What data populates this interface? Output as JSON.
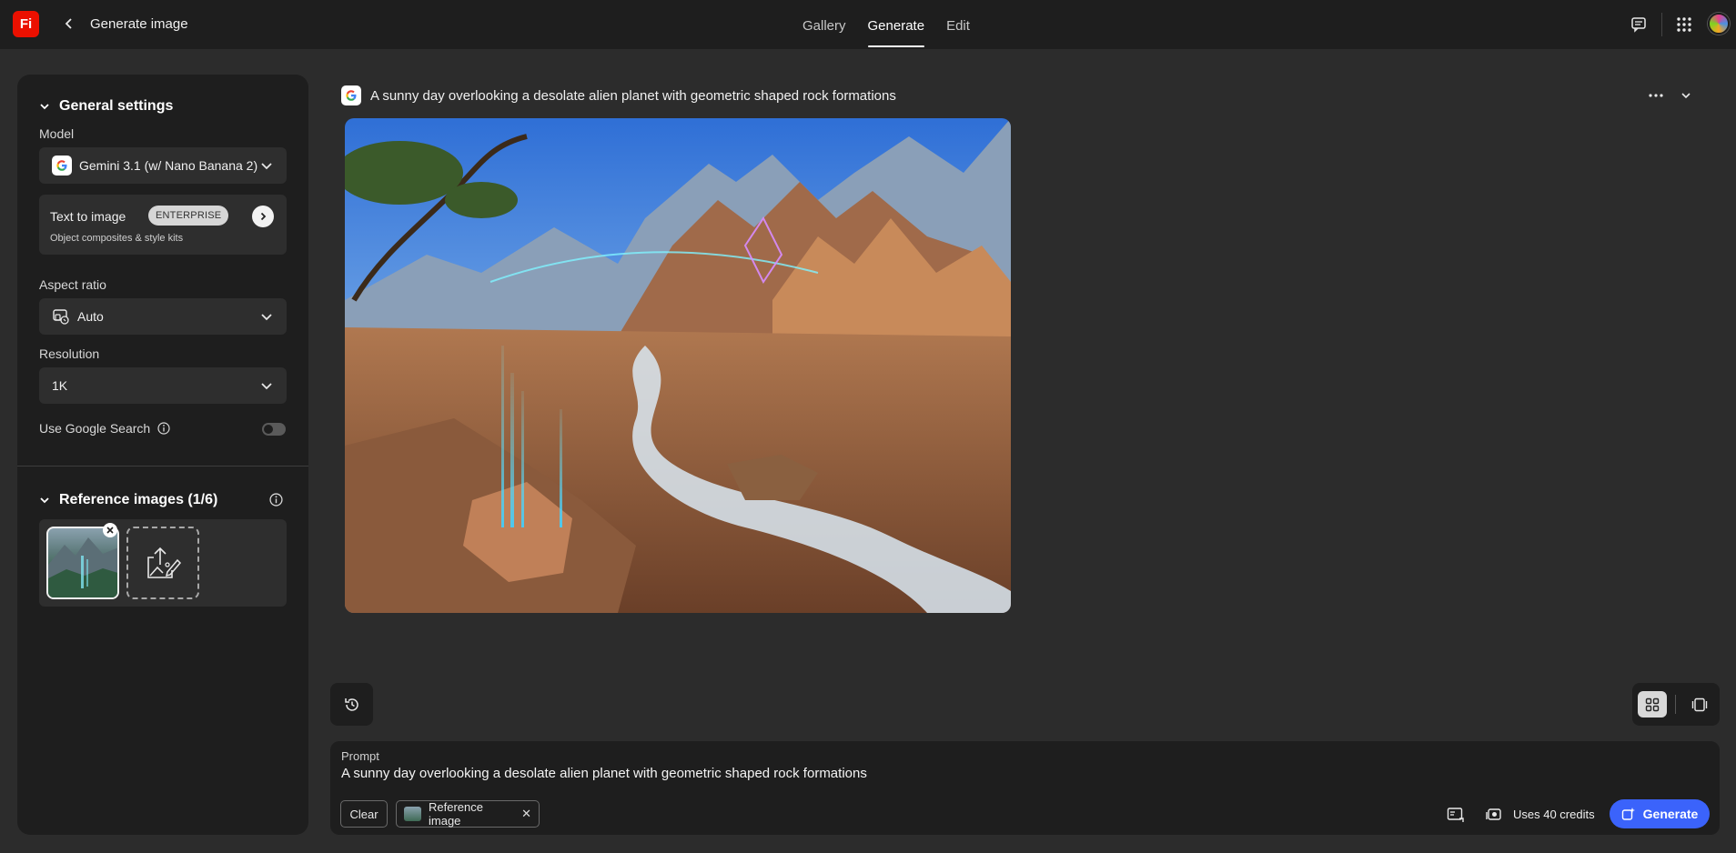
{
  "app": {
    "logo_text": "Fi",
    "page_title": "Generate image",
    "brand_color": "#eb1000",
    "accent_color": "#3b63fb"
  },
  "nav": {
    "tabs": [
      {
        "label": "Gallery"
      },
      {
        "label": "Generate"
      },
      {
        "label": "Edit"
      }
    ],
    "active": "Generate"
  },
  "sidebar": {
    "general_settings_title": "General settings",
    "model_label": "Model",
    "model_value": "Gemini 3.1 (w/ Nano Banana 2)",
    "mode_title": "Text to image",
    "mode_badge": "ENTERPRISE",
    "mode_subtitle": "Object composites & style kits",
    "aspect_label": "Aspect ratio",
    "aspect_value": "Auto",
    "resolution_label": "Resolution",
    "resolution_value": "1K",
    "google_search_label": "Use Google Search",
    "google_search_enabled": false,
    "reference_title": "Reference images (1/6)"
  },
  "generation": {
    "title": "A sunny day overlooking a desolate alien planet with geometric shaped rock formations"
  },
  "prompt": {
    "label": "Prompt",
    "text": "A sunny day overlooking a desolate alien planet with geometric shaped rock formations",
    "clear_label": "Clear",
    "reference_chip_label": "Reference image",
    "credits_text": "Uses 40 credits",
    "generate_label": "Generate"
  },
  "icons": [
    "back-icon",
    "chat-icon",
    "apps-grid-icon",
    "google-icon",
    "chevron-down-icon",
    "aspect-ratio-icon",
    "arrow-right-icon",
    "info-icon",
    "close-icon",
    "upload-image-icon",
    "more-icon",
    "history-icon",
    "grid-view-icon",
    "single-view-icon",
    "image-settings-icon",
    "credits-icon",
    "generate-sparkle-icon"
  ]
}
